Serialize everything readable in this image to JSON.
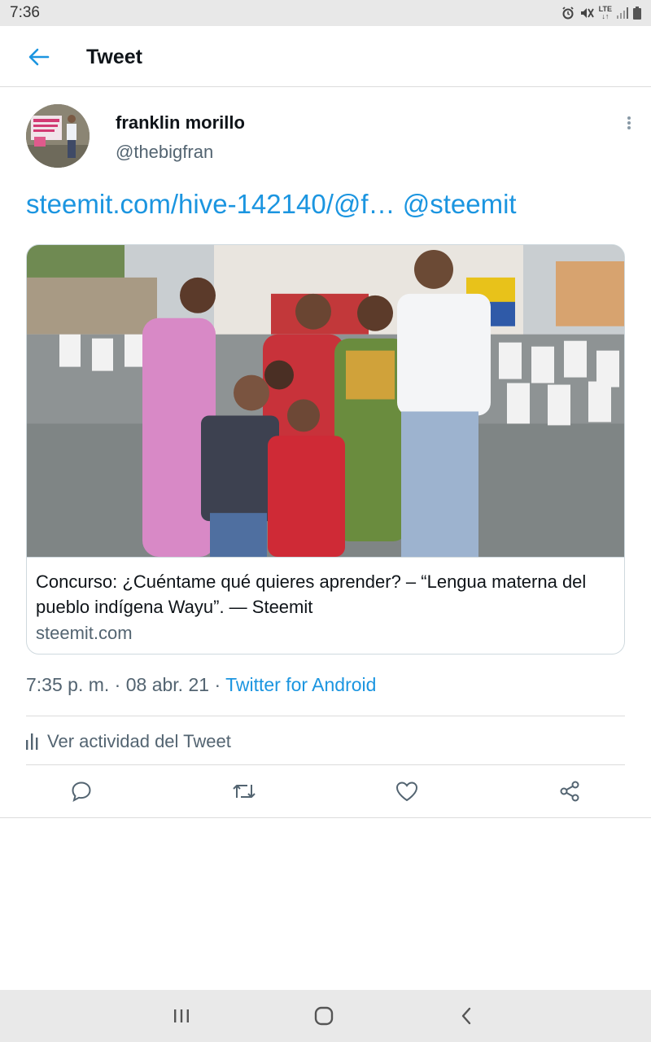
{
  "status_bar": {
    "time": "7:36",
    "network": "LTE",
    "icons": [
      "alarm-icon",
      "mute-icon",
      "lte-icon",
      "signal-icon",
      "battery-icon"
    ]
  },
  "header": {
    "title": "Tweet",
    "back_icon": "arrow-left-icon"
  },
  "tweet": {
    "author_name": "franklin morillo",
    "author_handle": "@thebigfran",
    "text_link": "steemit.com/hive-142140/@f…",
    "text_mention": "@steemit",
    "card": {
      "title": "Concurso: ¿Cuéntame qué quieres aprender? – “Lengua materna del pueblo indígena Wayu”. — Steemit",
      "domain": "steemit.com"
    },
    "time": "7:35 p. m.",
    "date": "08 abr. 21",
    "source": "Twitter for Android",
    "activity_label": "Ver actividad del Tweet"
  },
  "actions": [
    "reply-icon",
    "retweet-icon",
    "like-icon",
    "share-icon"
  ],
  "colors": {
    "accent": "#1b95e0",
    "text": "#0f1419",
    "secondary_text": "#536471",
    "divider": "#dcdcdc"
  }
}
